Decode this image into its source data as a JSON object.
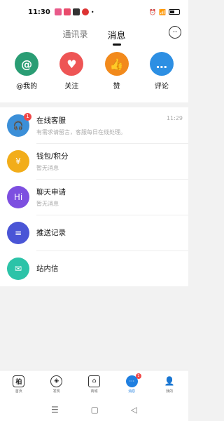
{
  "status_bar": {
    "time": "11:30",
    "battery": "28"
  },
  "header": {
    "tabs": [
      {
        "label": "通讯录",
        "active": false
      },
      {
        "label": "消息",
        "active": true
      }
    ]
  },
  "quick_actions": [
    {
      "label": "@我的",
      "icon": "at-icon",
      "glyph": "@",
      "color": "#2a9d74"
    },
    {
      "label": "关注",
      "icon": "heart-icon",
      "glyph": "♥",
      "color": "#ee5555"
    },
    {
      "label": "赞",
      "icon": "thumbs-up-icon",
      "glyph": "👍",
      "color": "#f28a1c"
    },
    {
      "label": "评论",
      "icon": "comment-icon",
      "glyph": "…",
      "color": "#2d8fe3"
    }
  ],
  "messages": [
    {
      "title": "在线客服",
      "subtitle": "有需求请留言，客服每日在线处理。",
      "time": "11:29",
      "badge": "1",
      "color": "#3b8fd8",
      "icon": "headset-icon",
      "glyph": "🎧"
    },
    {
      "title": "钱包/积分",
      "subtitle": "暂无消息",
      "time": "",
      "badge": "",
      "color": "#f2ad1a",
      "icon": "coins-icon",
      "glyph": "¥"
    },
    {
      "title": "聊天申请",
      "subtitle": "暂无消息",
      "time": "",
      "badge": "",
      "color": "#7d4fe0",
      "icon": "chat-bubble-icon",
      "glyph": "Hi"
    },
    {
      "title": "推送记录",
      "subtitle": "",
      "time": "",
      "badge": "",
      "color": "#4a55d6",
      "icon": "document-icon",
      "glyph": "≡"
    },
    {
      "title": "站内信",
      "subtitle": "",
      "time": "",
      "badge": "",
      "color": "#2cc3a8",
      "icon": "envelope-icon",
      "glyph": "✉"
    }
  ],
  "bottom_nav": [
    {
      "label": "首页",
      "icon": "home-logo-icon",
      "glyph": "柏",
      "badge": "",
      "active": false
    },
    {
      "label": "发现",
      "icon": "compass-icon",
      "glyph": "◎",
      "badge": "",
      "active": false
    },
    {
      "label": "商城",
      "icon": "store-icon",
      "glyph": "⌂",
      "badge": "",
      "active": false
    },
    {
      "label": "消息",
      "icon": "message-icon",
      "glyph": "💬",
      "badge": "1",
      "active": true
    },
    {
      "label": "我的",
      "icon": "user-icon",
      "glyph": "👤",
      "badge": "",
      "active": false
    }
  ],
  "system_nav": {
    "menu": "☰",
    "home": "▢",
    "back": "◁"
  }
}
